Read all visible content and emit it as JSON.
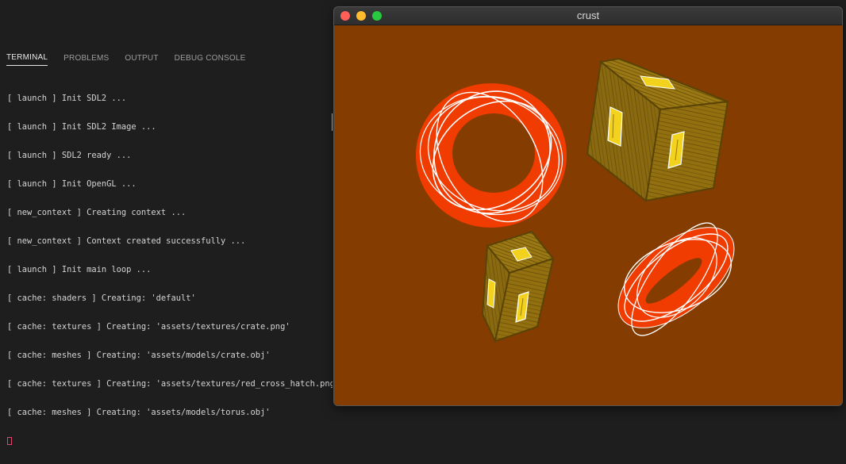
{
  "panel": {
    "tabs": [
      {
        "label": "TERMINAL",
        "active": true
      },
      {
        "label": "PROBLEMS",
        "active": false
      },
      {
        "label": "OUTPUT",
        "active": false
      },
      {
        "label": "DEBUG CONSOLE",
        "active": false
      }
    ]
  },
  "terminal": {
    "lines": [
      "[ launch ] Init SDL2 ...",
      "[ launch ] Init SDL2 Image ...",
      "[ launch ] SDL2 ready ...",
      "[ launch ] Init OpenGL ...",
      "[ new_context ] Creating context ...",
      "[ new_context ] Context created successfully ...",
      "[ launch ] Init main loop ...",
      "[ cache: shaders ] Creating: 'default'",
      "[ cache: textures ] Creating: 'assets/textures/crate.png'",
      "[ cache: meshes ] Creating: 'assets/models/crate.obj'",
      "[ cache: textures ] Creating: 'assets/textures/red_cross_hatch.png'",
      "[ cache: meshes ] Creating: 'assets/models/torus.obj'"
    ]
  },
  "window": {
    "title": "crust",
    "background_color": "#843c00",
    "objects": [
      "torus",
      "crate",
      "crate",
      "torus"
    ]
  },
  "colors": {
    "torus": "#f03c00",
    "crate": "#8a6a10",
    "crate_light": "#a07d18",
    "crate_emblem": "#f2d21c"
  }
}
